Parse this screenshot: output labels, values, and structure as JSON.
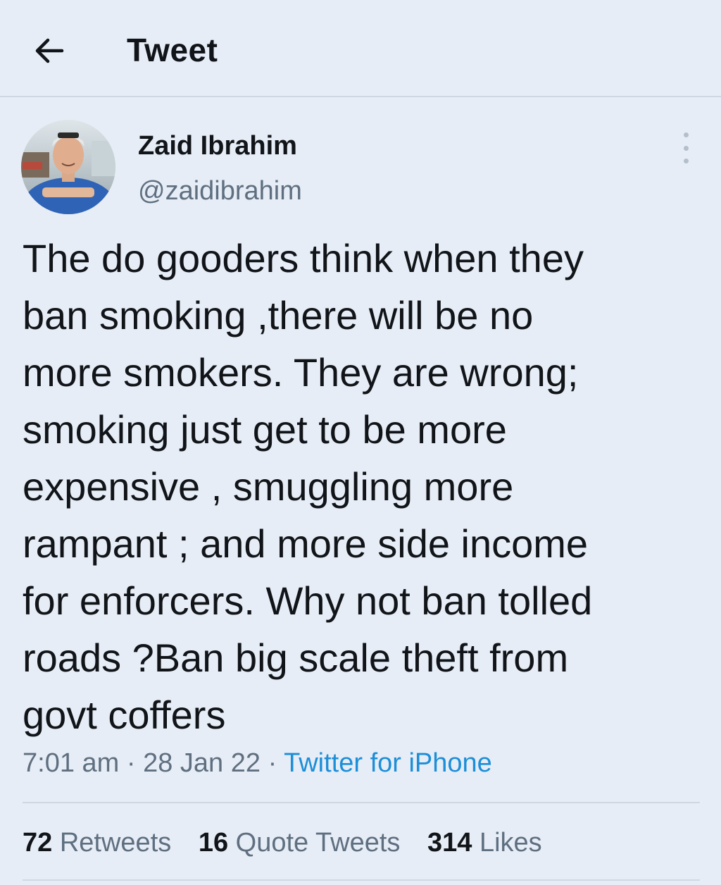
{
  "header": {
    "title": "Tweet",
    "back_icon": "arrow-left-icon"
  },
  "author": {
    "name": "Zaid Ibrahim",
    "handle": "@zaidibrahim",
    "more_icon": "more-vertical-icon"
  },
  "tweet": {
    "text": "The do gooders think when they\nban smoking ,there will be no\nmore smokers. They are wrong;\nsmoking just get to be more\nexpensive , smuggling more\nrampant ; and more side income\nfor enforcers. Why not ban tolled\nroads ?Ban big scale theft from\ngovt coffers",
    "time": "7:01 am",
    "separator1": " · ",
    "date": "28 Jan 22",
    "separator2": " · ",
    "source": "Twitter for iPhone"
  },
  "stats": {
    "retweets_count": "72",
    "retweets_label": "Retweets",
    "quotes_count": "16",
    "quotes_label": "Quote Tweets",
    "likes_count": "314",
    "likes_label": "Likes"
  },
  "colors": {
    "background": "#e6edf6",
    "text": "#111418",
    "secondary": "#5f6f80",
    "link": "#1d8ed8",
    "divider": "#cfd8e2"
  }
}
